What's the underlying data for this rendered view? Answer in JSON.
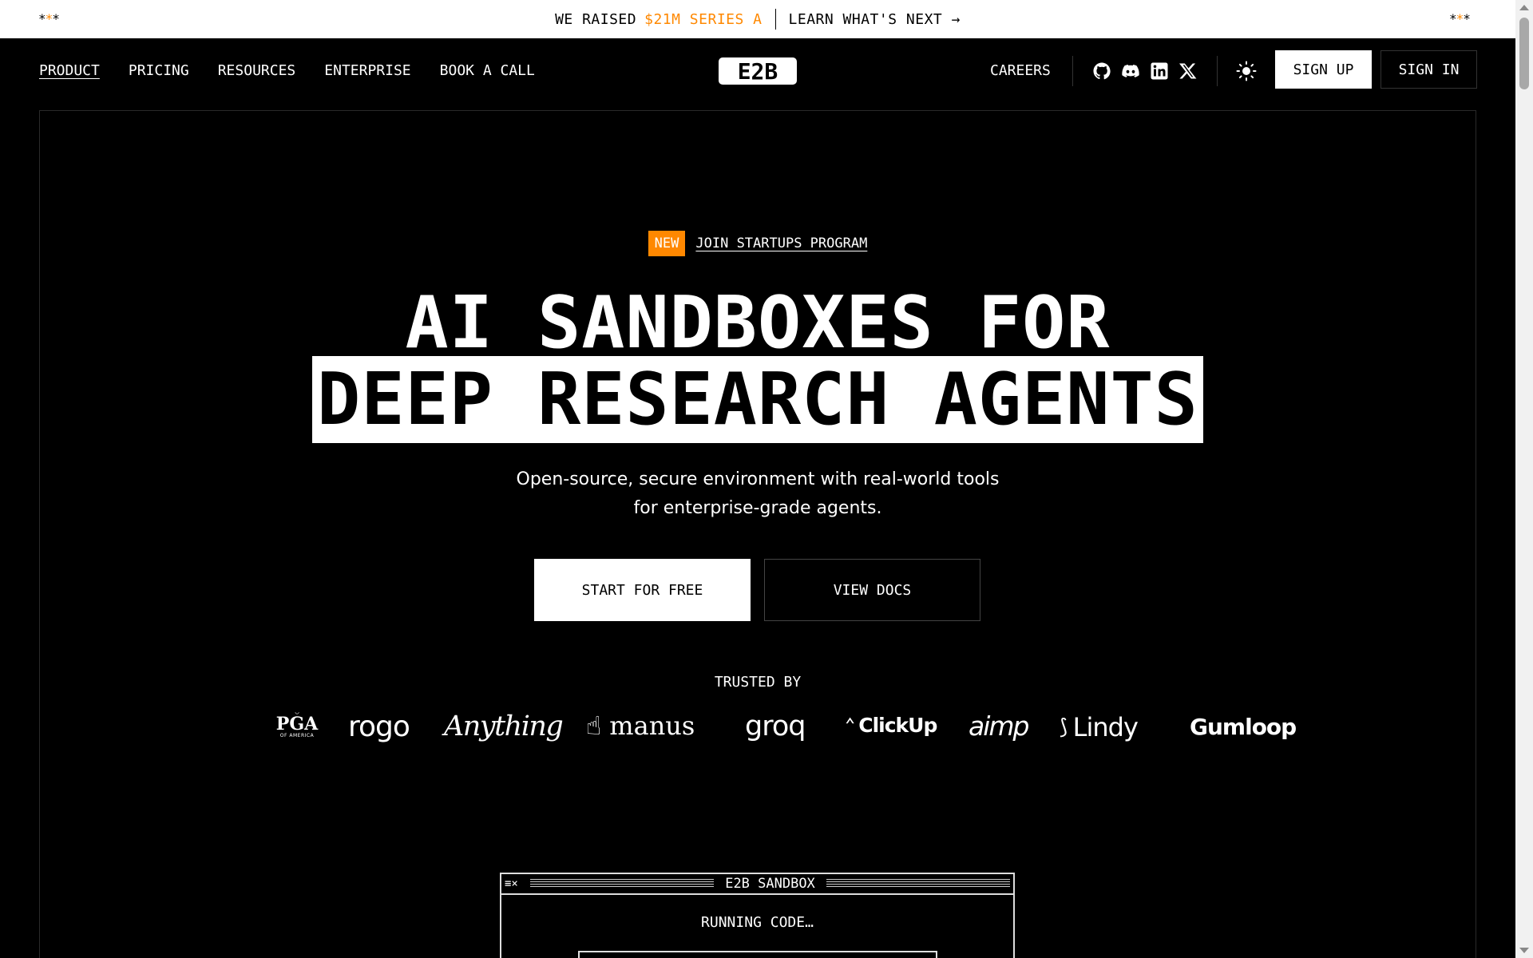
{
  "announcement": {
    "stars_left": "***",
    "stars_right": "***",
    "raised_prefix": "WE RAISED",
    "raised_amount": "$21M SERIES A",
    "link": "LEARN WHAT'S NEXT →"
  },
  "nav": {
    "items": [
      "PRODUCT",
      "PRICING",
      "RESOURCES",
      "ENTERPRISE",
      "BOOK A CALL"
    ],
    "active": "PRODUCT",
    "logo": "E2B",
    "careers": "CAREERS",
    "social_icons": [
      "github-icon",
      "discord-icon",
      "linkedin-icon",
      "x-icon"
    ],
    "theme_icon": "sun-icon",
    "sign_up": "SIGN UP",
    "sign_in": "SIGN IN"
  },
  "hero": {
    "badge": "NEW",
    "badge_link": "JOIN STARTUPS PROGRAM",
    "title_line1": "AI SANDBOXES FOR",
    "title_line2": "DEEP RESEARCH AGENTS",
    "subtitle_line1": "Open-source, secure environment with real-world tools",
    "subtitle_line2": "for enterprise-grade agents.",
    "cta_primary": "START FOR FREE",
    "cta_secondary": "VIEW DOCS"
  },
  "trusted": {
    "label": "TRUSTED BY",
    "logos": [
      "PGA",
      "rogo",
      "Anything",
      "manus",
      "groq",
      "ClickUp",
      "aimp",
      "Lindy",
      "Gumloop"
    ],
    "pga_sub": "OF AMERICA"
  },
  "sandbox": {
    "title": "E2B SANDBOX",
    "controls": "≡×",
    "status": "RUNNING CODE…"
  },
  "colors": {
    "accent": "#ff8800",
    "background": "#000000",
    "foreground": "#ffffff"
  }
}
